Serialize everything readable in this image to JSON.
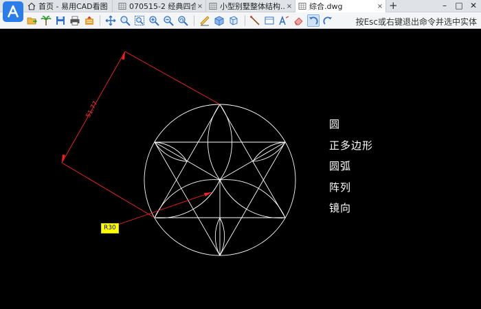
{
  "tabs": [
    {
      "label": "首页 - 易用CAD看图",
      "icon": "home-icon",
      "closable": false,
      "active": false
    },
    {
      "label": "070515-2 经典四合...",
      "icon": "drawing-icon",
      "closable": true,
      "active": false
    },
    {
      "label": "小型别墅整体结构...",
      "icon": "drawing-icon",
      "closable": true,
      "active": false
    },
    {
      "label": "综合.dwg",
      "icon": "drawing-icon",
      "closable": true,
      "active": true
    }
  ],
  "tab_close_glyph": "×",
  "tab_add_glyph": "+",
  "window_controls": {
    "minimize": "–",
    "maximize": "□",
    "close": "✕"
  },
  "toolbar": {
    "hint": "按Esc或右键退出命令并选中实体",
    "buttons": [
      "open-file-icon",
      "palm-tree-icon",
      "save-icon",
      "print-icon",
      "share-icon",
      "pan-icon",
      "zoom-window-icon",
      "zoom-extents-icon",
      "zoom-in-icon",
      "zoom-out-icon",
      "layer-icon",
      "3d-box-icon",
      "3d-view-icon",
      "measure-line-icon",
      "measure-area-icon",
      "text-icon",
      "erase-icon",
      "undo-icon",
      "redo-icon"
    ]
  },
  "drawing": {
    "dimension_value": "51.77",
    "radius_label": "R30",
    "legend": [
      "圆",
      "正多边形",
      "圆弧",
      "阵列",
      "镜向"
    ],
    "colors": {
      "background": "#000000",
      "geometry": "#ffffff",
      "dimension": "#ff2020",
      "tag": "#ffff00"
    }
  }
}
